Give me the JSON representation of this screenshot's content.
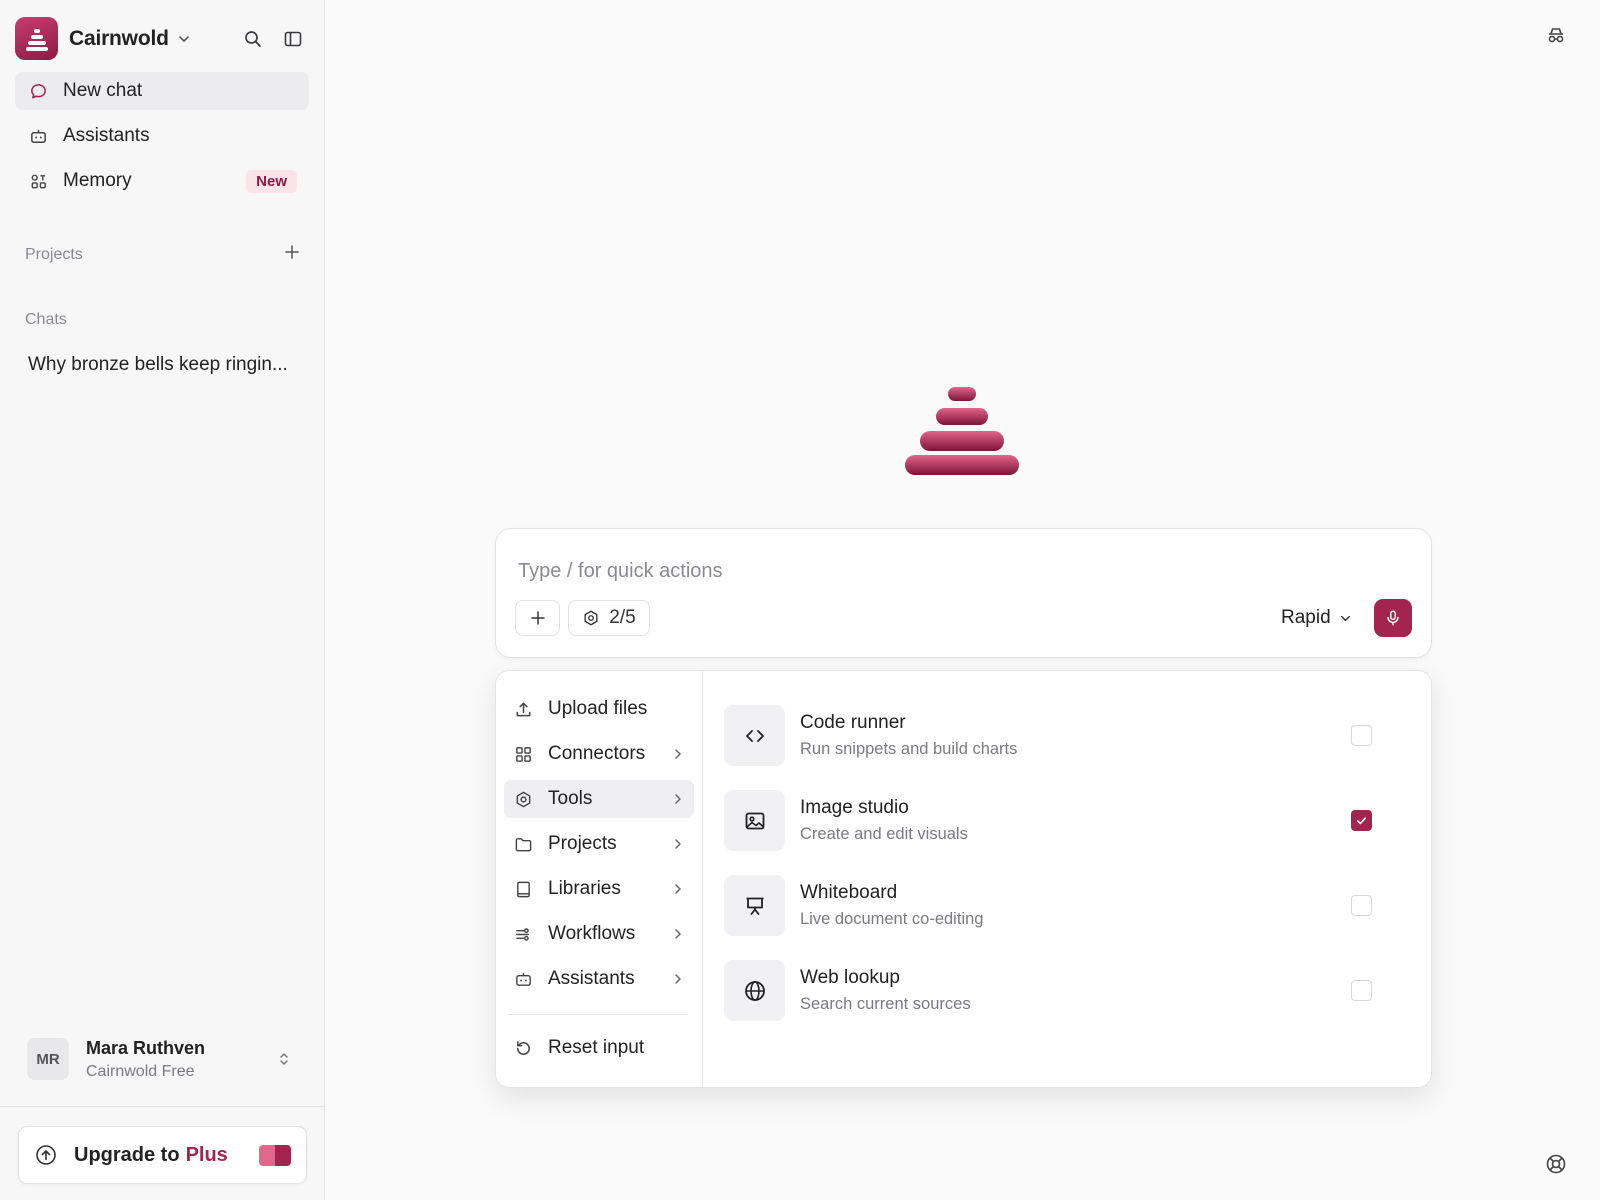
{
  "app": {
    "name": "Cairnwold",
    "brand_color": "#a3254f"
  },
  "sidebar": {
    "nav": [
      {
        "label": "New chat",
        "icon": "chat-bubble-icon",
        "active": true
      },
      {
        "label": "Assistants",
        "icon": "robot-icon"
      },
      {
        "label": "Memory",
        "icon": "memory-icon",
        "badge": "New"
      }
    ],
    "projects_label": "Projects",
    "chats_label": "Chats",
    "chats": [
      "Why bronze bells keep ringin..."
    ],
    "user": {
      "initials": "MR",
      "name": "Mara Ruthven",
      "plan": "Cairnwold Free"
    },
    "upgrade": {
      "prefix": "Upgrade to",
      "plan": "Plus"
    }
  },
  "composer": {
    "placeholder": "Type / for quick actions",
    "tools_count": "2/5",
    "model": "Rapid"
  },
  "menu": {
    "items": [
      {
        "label": "Upload files",
        "icon": "upload-icon",
        "submenu": false
      },
      {
        "label": "Connectors",
        "icon": "grid-icon",
        "submenu": true
      },
      {
        "label": "Tools",
        "icon": "hexagon-gear-icon",
        "submenu": true,
        "active": true
      },
      {
        "label": "Projects",
        "icon": "folder-icon",
        "submenu": true
      },
      {
        "label": "Libraries",
        "icon": "book-icon",
        "submenu": true
      },
      {
        "label": "Workflows",
        "icon": "workflow-icon",
        "submenu": true
      },
      {
        "label": "Assistants",
        "icon": "robot-icon",
        "submenu": true
      }
    ],
    "reset": {
      "label": "Reset input",
      "icon": "reset-icon"
    }
  },
  "tools": [
    {
      "title": "Code runner",
      "desc": "Run snippets and build charts",
      "icon": "code-icon",
      "checked": false
    },
    {
      "title": "Image studio",
      "desc": "Create and edit visuals",
      "icon": "image-icon",
      "checked": true
    },
    {
      "title": "Whiteboard",
      "desc": "Live document co-editing",
      "icon": "presentation-icon",
      "checked": false
    },
    {
      "title": "Web lookup",
      "desc": "Search current sources",
      "icon": "globe-icon",
      "checked": false
    }
  ]
}
